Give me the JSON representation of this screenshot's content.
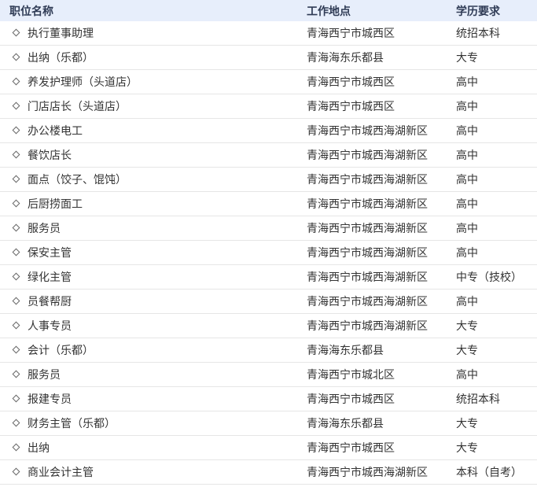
{
  "table": {
    "headers": {
      "name": "职位名称",
      "location": "工作地点",
      "education": "学历要求"
    },
    "rows": [
      {
        "name": "执行董事助理",
        "location": "青海西宁市城西区",
        "education": "统招本科"
      },
      {
        "name": "出纳（乐都）",
        "location": "青海海东乐都县",
        "education": "大专"
      },
      {
        "name": "养发护理师（头道店）",
        "location": "青海西宁市城西区",
        "education": "高中"
      },
      {
        "name": "门店店长（头道店）",
        "location": "青海西宁市城西区",
        "education": "高中"
      },
      {
        "name": "办公楼电工",
        "location": "青海西宁市城西海湖新区",
        "education": "高中"
      },
      {
        "name": "餐饮店长",
        "location": "青海西宁市城西海湖新区",
        "education": "高中"
      },
      {
        "name": "面点（饺子、馄饨）",
        "location": "青海西宁市城西海湖新区",
        "education": "高中"
      },
      {
        "name": "后厨捞面工",
        "location": "青海西宁市城西海湖新区",
        "education": "高中"
      },
      {
        "name": "服务员",
        "location": "青海西宁市城西海湖新区",
        "education": "高中"
      },
      {
        "name": "保安主管",
        "location": "青海西宁市城西海湖新区",
        "education": "高中"
      },
      {
        "name": "绿化主管",
        "location": "青海西宁市城西海湖新区",
        "education": "中专（技校）"
      },
      {
        "name": "员餐帮厨",
        "location": "青海西宁市城西海湖新区",
        "education": "高中"
      },
      {
        "name": "人事专员",
        "location": "青海西宁市城西海湖新区",
        "education": "大专"
      },
      {
        "name": "会计（乐都）",
        "location": "青海海东乐都县",
        "education": "大专"
      },
      {
        "name": "服务员",
        "location": "青海西宁市城北区",
        "education": "高中"
      },
      {
        "name": "报建专员",
        "location": "青海西宁市城西区",
        "education": "统招本科"
      },
      {
        "name": "财务主管（乐都）",
        "location": "青海海东乐都县",
        "education": "大专"
      },
      {
        "name": "出纳",
        "location": "青海西宁市城西区",
        "education": "大专"
      },
      {
        "name": "商业会计主管",
        "location": "青海西宁市城西海湖新区",
        "education": "本科（自考）"
      }
    ]
  }
}
